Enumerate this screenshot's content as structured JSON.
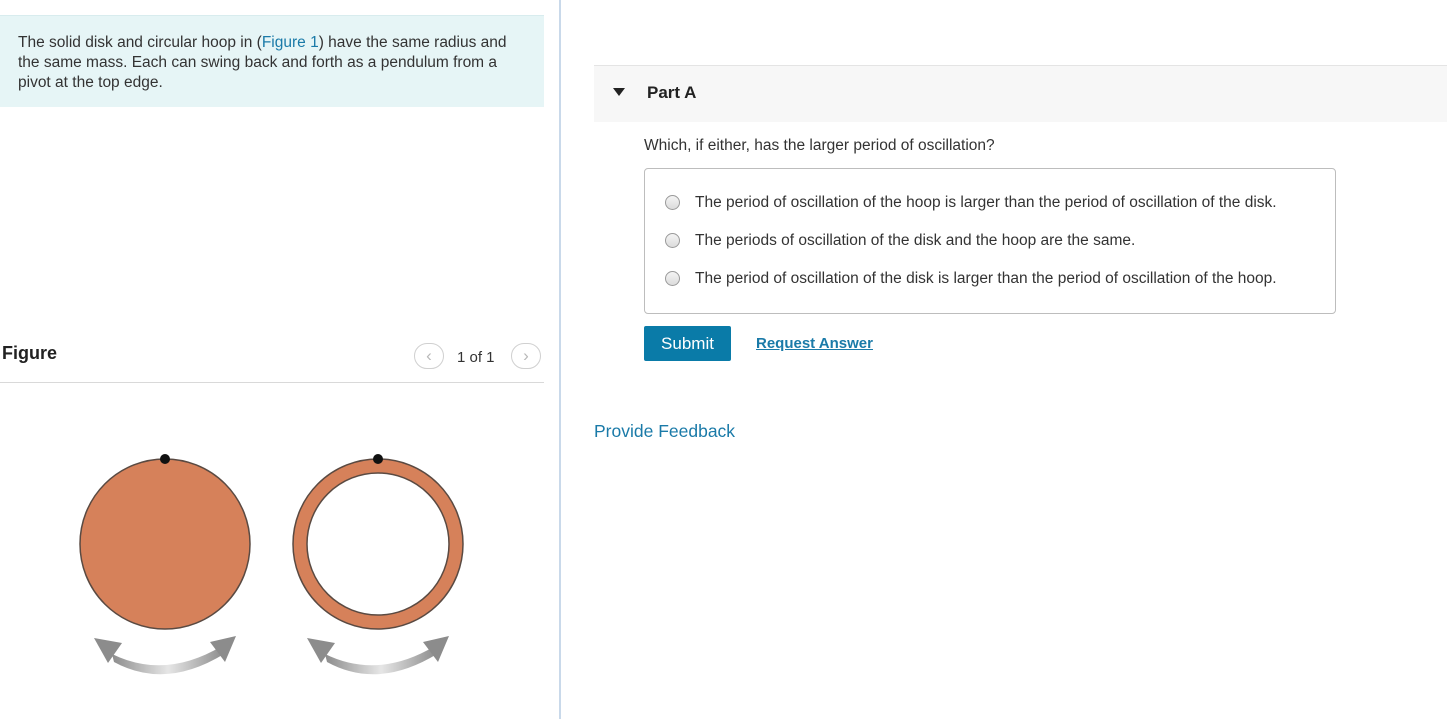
{
  "problem": {
    "intro_before_link": "The solid disk and circular hoop in (",
    "intro_link": "Figure 1",
    "intro_after_link": ") have the same radius and the same mass. Each can swing back and forth as a pendulum from a pivot at the top edge."
  },
  "figure": {
    "title": "Figure",
    "pager_prev": "‹",
    "pager_count": "1 of 1",
    "pager_next": "›",
    "disk_color": "#d6815a",
    "arrow_color": "#9a9a9a"
  },
  "part": {
    "title": "Part A",
    "question": "Which, if either, has the larger period of oscillation?",
    "options": [
      {
        "label": "The period of oscillation of the hoop is larger than the period of oscillation of the disk.",
        "selected": false
      },
      {
        "label": "The periods of oscillation of the disk and the hoop are the same.",
        "selected": false
      },
      {
        "label": "The period of oscillation of the disk is larger than the period of oscillation of the hoop.",
        "selected": false
      }
    ],
    "submit_label": "Submit",
    "request_answer_label": "Request Answer"
  },
  "footer": {
    "feedback_label": "Provide Feedback"
  },
  "colors": {
    "accent": "#0a7ba8",
    "link": "#1a7aa8",
    "intro_bg": "#e6f5f6"
  }
}
